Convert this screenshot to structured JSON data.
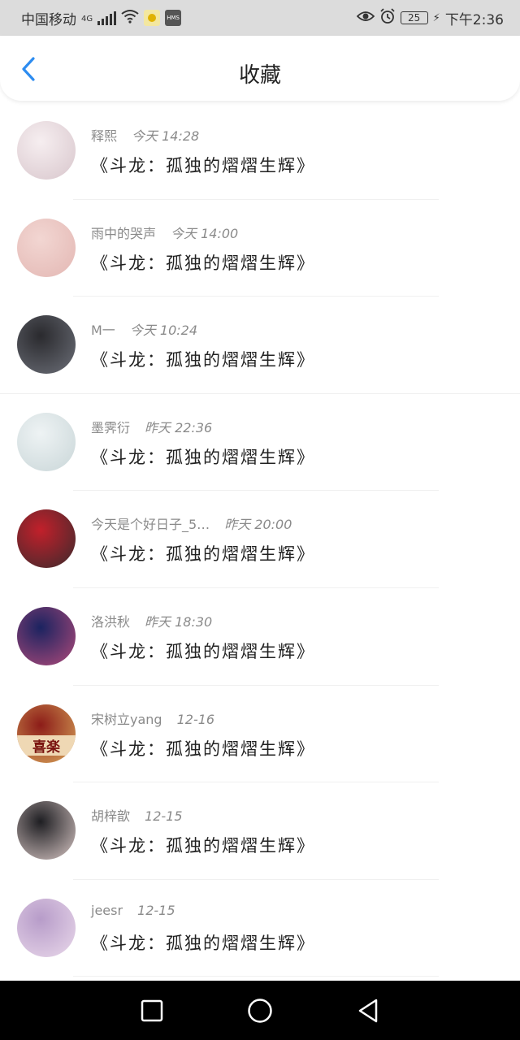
{
  "status_bar": {
    "carrier": "中国移动",
    "network": "4G",
    "battery": "25",
    "time": "下午2:36",
    "icons": [
      "signal-icon",
      "wifi-icon",
      "app-badge-icon",
      "hms-icon",
      "eye-icon",
      "alarm-icon",
      "battery-icon",
      "charging-icon"
    ]
  },
  "nav": {
    "title": "收藏",
    "back_icon": "chevron-left-icon",
    "accent_color": "#2d8cf0"
  },
  "items": [
    {
      "name": "释熙",
      "time": "今天 14:28",
      "content": "《斗龙：孤独的熠熠生辉》",
      "avatar_colors": [
        "#f6eef0",
        "#d8c6cc"
      ]
    },
    {
      "name": "雨中的哭声",
      "time": "今天 14:00",
      "content": "《斗龙：孤独的熠熠生辉》",
      "avatar_colors": [
        "#f2d6d2",
        "#e3b7b3"
      ]
    },
    {
      "name": "M一",
      "time": "今天 10:24",
      "content": "《斗龙：孤独的熠熠生辉》",
      "avatar_colors": [
        "#2a2a2e",
        "#6c6f78"
      ]
    },
    {
      "name": "墨霁衍",
      "time": "昨天 22:36",
      "content": "《斗龙：孤独的熠熠生辉》",
      "avatar_colors": [
        "#eef3f4",
        "#c9d6d8"
      ]
    },
    {
      "name": "今天是个好日子_5…",
      "time": "昨天 20:00",
      "content": "《斗龙：孤独的熠熠生辉》",
      "avatar_colors": [
        "#c2202b",
        "#3a2a2c"
      ]
    },
    {
      "name": "洛洪秋",
      "time": "昨天 18:30",
      "content": "《斗龙：孤独的熠熠生辉》",
      "avatar_colors": [
        "#1b2360",
        "#b04a7a"
      ]
    },
    {
      "name": "宋树立yang",
      "time": "12-16",
      "content": "《斗龙：孤独的熠熠生辉》",
      "avatar_colors": [
        "#8c1c18",
        "#d9a75a"
      ],
      "avatar_text": "喜楽"
    },
    {
      "name": "胡梓歆",
      "time": "12-15",
      "content": "《斗龙：孤独的熠熠生辉》",
      "avatar_colors": [
        "#1e1e22",
        "#d7c6c4"
      ]
    },
    {
      "name": "jeesr",
      "time": "12-15",
      "content": "《斗龙：孤独的熠熠生辉》",
      "avatar_colors": [
        "#b79cc9",
        "#e9d8ea"
      ]
    }
  ],
  "system_nav": {
    "recents_icon": "square-icon",
    "home_icon": "circle-icon",
    "back_icon": "triangle-back-icon"
  }
}
